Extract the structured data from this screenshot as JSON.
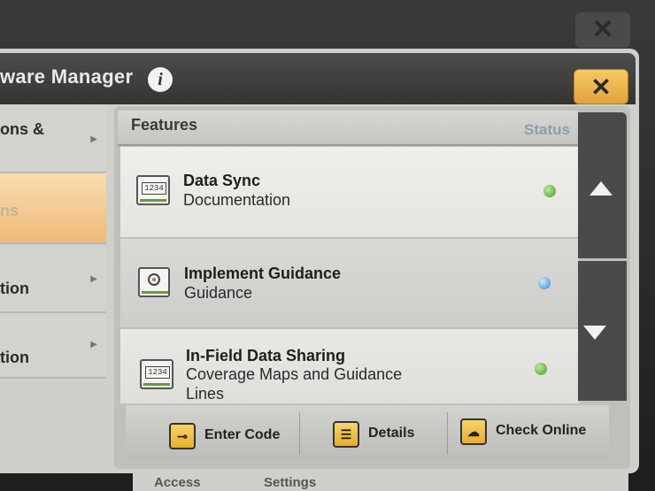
{
  "window": {
    "title": "ware Manager",
    "info_icon": "info-icon",
    "close_icon": "✕"
  },
  "top_close_icon": "✕",
  "sidebar": {
    "items": [
      {
        "label": "ons &",
        "active": false
      },
      {
        "label": "ns",
        "active": true
      },
      {
        "label": "tion",
        "active": false
      },
      {
        "label": "tion",
        "active": false
      }
    ],
    "active_color": "#f0c48a"
  },
  "features": {
    "header_label": "Features",
    "status_label": "Status",
    "rows": [
      {
        "name": "Data Sync",
        "subtitle": "Documentation",
        "icon": "display-icon",
        "status": "green"
      },
      {
        "name": "Implement Guidance",
        "subtitle": "Guidance",
        "icon": "compass-icon",
        "status": "blue"
      },
      {
        "name": "In-Field Data Sharing",
        "subtitle_line1": "Coverage Maps and Guidance",
        "subtitle_line2": "Lines",
        "icon": "display-icon",
        "status": "green"
      }
    ],
    "display_icon_text": "1234"
  },
  "footer": {
    "enter_code": "Enter Code",
    "details": "Details",
    "check_online": "Check Online"
  },
  "bottom_tabs": {
    "left": "Access",
    "right": "Settings"
  },
  "colors": {
    "status_green": "#4a9a2a",
    "status_blue": "#2a8ad0",
    "accent_yellow": "#e8ae2c"
  }
}
